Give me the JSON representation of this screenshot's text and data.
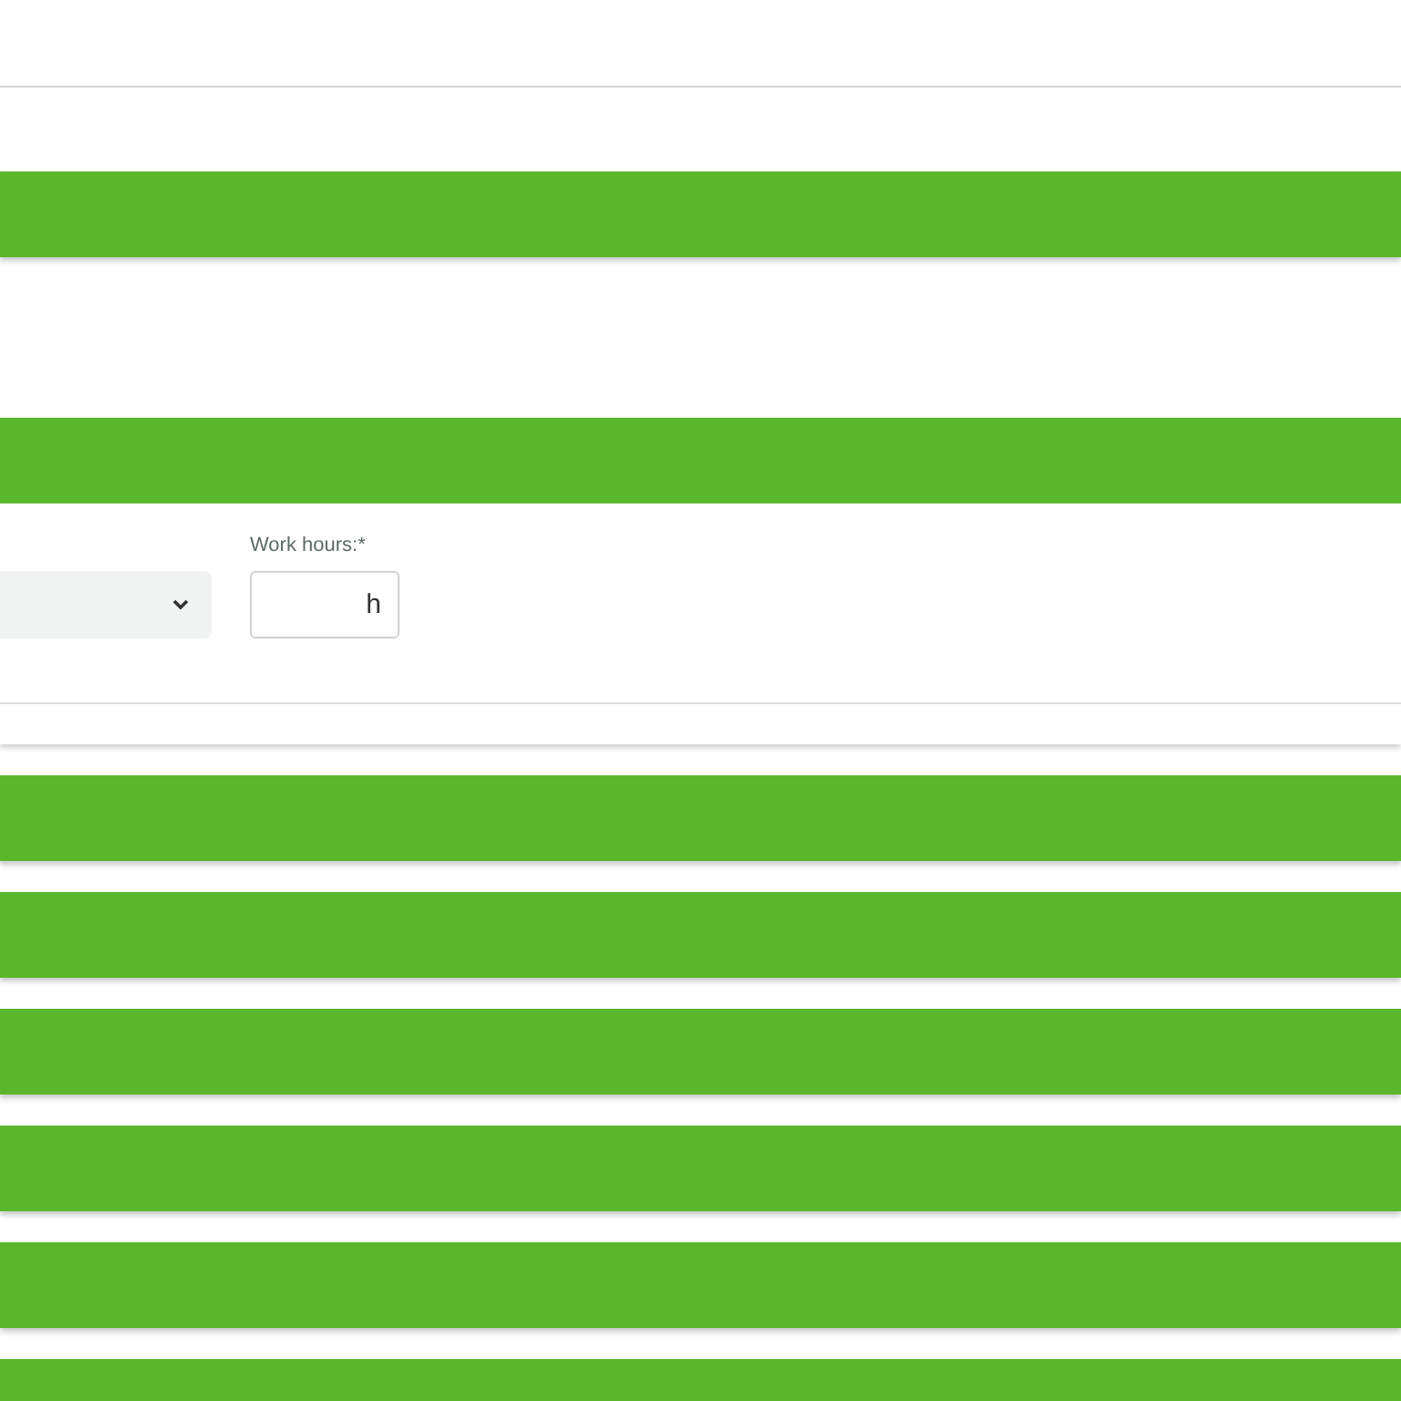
{
  "sections": [
    {
      "kind": "bar"
    },
    {
      "kind": "bar"
    },
    {
      "kind": "form",
      "fields": [
        {
          "kind": "select"
        },
        {
          "kind": "number",
          "label": "Work hours:*",
          "unit": "h"
        }
      ]
    },
    {
      "kind": "bar"
    },
    {
      "kind": "bar"
    },
    {
      "kind": "bar"
    },
    {
      "kind": "bar"
    },
    {
      "kind": "bar"
    },
    {
      "kind": "bar"
    }
  ]
}
